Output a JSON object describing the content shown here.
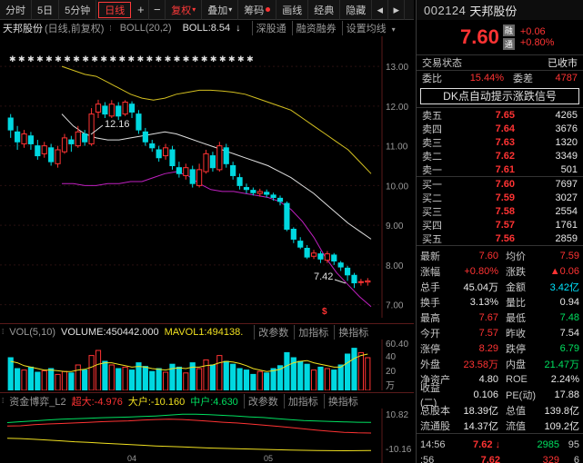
{
  "toolbar": {
    "fenshi": "分时",
    "day5": "5日",
    "min5": "5分钟",
    "daily": "日线",
    "plus": "+",
    "minus": "−",
    "fuquan": "复权",
    "overlay": "叠加",
    "chips": "筹码",
    "draw": "画线",
    "classic": "经典",
    "hide": "隐藏",
    "back": "◂",
    "fwd": "▸"
  },
  "kline_info": {
    "stock": "天邦股份",
    "mode": "(日线,前复权)",
    "boll": "BOLL(20,2)",
    "boll_val": "BOLL:8.54",
    "tab1": "深股通",
    "tab2": "融资融券",
    "tab3": "设置均线"
  },
  "kline_axis": {
    "ticks": [
      "13.00",
      "12.00",
      "11.00",
      "10.00",
      "9.00",
      "8.00",
      "7.00"
    ]
  },
  "kline_annotations": {
    "high": "12.16",
    "low": "7.42",
    "marker": "$"
  },
  "vol_info": {
    "title": "VOL(5,10)",
    "volume": "VOLUME:450442.000",
    "mavol": "MAVOL1:494138.",
    "param": "改参数",
    "add": "加指标",
    "swap": "换指标"
  },
  "vol_axis": {
    "ticks": [
      "60.40",
      "40",
      "20"
    ],
    "unit": "万"
  },
  "capital_info": {
    "title": "资金博弈_L2",
    "super": "超大:-4.976",
    "large": "大户:-10.160",
    "mid": "中户:4.630",
    "param": "改参数",
    "add": "加指标",
    "swap": "换指标"
  },
  "capital_axis": {
    "ticks": [
      "10.82",
      "-10.16"
    ]
  },
  "xaxis": {
    "labels": [
      "04",
      "05"
    ]
  },
  "quote": {
    "code": "002124",
    "name": "天邦股份",
    "price": "7.60",
    "badge1": "融",
    "badge2": "通",
    "change": "+0.06",
    "change_pct": "+0.80%",
    "status_label": "交易状态",
    "status_value": "已收市",
    "weibi_label": "委比",
    "weibi_value": "15.44%",
    "weicha_label": "委差",
    "weicha_value": "4787",
    "signal": "DK点自动提示涨跌信号"
  },
  "orderbook": {
    "asks": [
      {
        "label": "卖五",
        "price": "7.65",
        "vol": "4265"
      },
      {
        "label": "卖四",
        "price": "7.64",
        "vol": "3676"
      },
      {
        "label": "卖三",
        "price": "7.63",
        "vol": "1320"
      },
      {
        "label": "卖二",
        "price": "7.62",
        "vol": "3349"
      },
      {
        "label": "卖一",
        "price": "7.61",
        "vol": "501"
      }
    ],
    "bids": [
      {
        "label": "买一",
        "price": "7.60",
        "vol": "7697"
      },
      {
        "label": "买二",
        "price": "7.59",
        "vol": "3027"
      },
      {
        "label": "买三",
        "price": "7.58",
        "vol": "2554"
      },
      {
        "label": "买四",
        "price": "7.57",
        "vol": "1761"
      },
      {
        "label": "买五",
        "price": "7.56",
        "vol": "2859"
      }
    ]
  },
  "stats": [
    {
      "a": "最新",
      "b": "7.60",
      "bc": "#ff3333",
      "c": "均价",
      "d": "7.59",
      "dc": "#ff3333"
    },
    {
      "a": "涨幅",
      "b": "+0.80%",
      "bc": "#ff3333",
      "c": "涨跌",
      "d": "▲0.06",
      "dc": "#ff3333"
    },
    {
      "a": "总手",
      "b": "45.04万",
      "bc": "#e8e8e8",
      "c": "金额",
      "d": "3.42亿",
      "dc": "#00e5ff"
    },
    {
      "a": "换手",
      "b": "3.13%",
      "bc": "#e8e8e8",
      "c": "量比",
      "d": "0.94",
      "dc": "#e8e8e8"
    },
    {
      "a": "最高",
      "b": "7.67",
      "bc": "#ff3333",
      "c": "最低",
      "d": "7.48",
      "dc": "#00e060"
    },
    {
      "a": "今开",
      "b": "7.57",
      "bc": "#ff3333",
      "c": "昨收",
      "d": "7.54",
      "dc": "#e8e8e8"
    },
    {
      "a": "涨停",
      "b": "8.29",
      "bc": "#ff3333",
      "c": "跌停",
      "d": "6.79",
      "dc": "#00e060"
    },
    {
      "a": "外盘",
      "b": "23.58万",
      "bc": "#ff3333",
      "c": "内盘",
      "d": "21.47万",
      "dc": "#00e060"
    },
    {
      "a": "净资产",
      "b": "4.80",
      "bc": "#e8e8e8",
      "c": "ROE",
      "d": "2.24%",
      "dc": "#e8e8e8"
    },
    {
      "a": "收益(二)",
      "b": "0.106",
      "bc": "#e8e8e8",
      "c": "PE(动)",
      "d": "17.88",
      "dc": "#e8e8e8"
    },
    {
      "a": "总股本",
      "b": "18.39亿",
      "bc": "#e8e8e8",
      "c": "总值",
      "d": "139.8亿",
      "dc": "#e8e8e8"
    },
    {
      "a": "流通股",
      "b": "14.37亿",
      "bc": "#e8e8e8",
      "c": "流值",
      "d": "109.2亿",
      "dc": "#e8e8e8"
    }
  ],
  "ticks": [
    {
      "t": "14:56",
      "p": "7.62",
      "arrow": "↓",
      "v": "2985",
      "vc": "#00e060",
      "k": "95"
    },
    {
      "t": ":56",
      "p": "7.62",
      "arrow": "",
      "v": "329",
      "vc": "#ff3333",
      "k": "6"
    },
    {
      "t": ":57",
      "p": "7.62",
      "arrow": "",
      "v": "137",
      "vc": "#ff3333",
      "k": "7"
    }
  ],
  "chart_data": {
    "type": "candlestick",
    "title": "天邦股份 (日线,前复权)",
    "ylim": [
      6.9,
      13.3
    ],
    "candles": [
      [
        11.7,
        11.4,
        11.8,
        11.2
      ],
      [
        11.35,
        11.1,
        11.5,
        10.9
      ],
      [
        11.05,
        11.3,
        11.4,
        10.95
      ],
      [
        11.25,
        11.05,
        11.35,
        10.9
      ],
      [
        11.0,
        10.75,
        11.15,
        10.65
      ],
      [
        10.8,
        11.0,
        11.1,
        10.7
      ],
      [
        10.95,
        10.6,
        11.05,
        10.5
      ],
      [
        10.55,
        10.9,
        11.0,
        10.45
      ],
      [
        10.85,
        11.2,
        11.3,
        10.8
      ],
      [
        11.15,
        11.05,
        11.25,
        10.85
      ],
      [
        11.0,
        11.35,
        11.5,
        10.95
      ],
      [
        11.3,
        11.1,
        11.4,
        11.0
      ],
      [
        11.05,
        11.8,
        11.95,
        11.0
      ],
      [
        11.85,
        12.05,
        12.16,
        11.7
      ],
      [
        12.0,
        11.8,
        12.1,
        11.7
      ],
      [
        11.75,
        12.05,
        12.15,
        11.7
      ],
      [
        12.0,
        11.75,
        12.1,
        11.65
      ],
      [
        11.8,
        12.1,
        12.15,
        11.75
      ],
      [
        12.05,
        11.85,
        12.12,
        11.7
      ],
      [
        11.8,
        11.4,
        11.9,
        11.3
      ],
      [
        11.35,
        11.1,
        11.45,
        11.0
      ],
      [
        11.05,
        10.95,
        11.15,
        10.85
      ],
      [
        10.9,
        10.7,
        11.0,
        10.6
      ],
      [
        10.75,
        10.95,
        11.05,
        10.65
      ],
      [
        10.9,
        10.5,
        11.0,
        10.4
      ],
      [
        10.45,
        10.3,
        10.6,
        10.2
      ],
      [
        10.25,
        10.45,
        10.55,
        10.15
      ],
      [
        10.4,
        10.05,
        10.5,
        9.95
      ],
      [
        10.0,
        10.4,
        10.55,
        9.95
      ],
      [
        10.35,
        10.8,
        10.9,
        10.3
      ],
      [
        10.75,
        10.45,
        10.85,
        10.35
      ],
      [
        10.4,
        11.0,
        11.1,
        10.35
      ],
      [
        10.95,
        10.55,
        11.05,
        10.45
      ],
      [
        10.5,
        10.25,
        10.6,
        10.15
      ],
      [
        10.2,
        10.0,
        10.3,
        9.9
      ],
      [
        9.95,
        9.9,
        10.05,
        9.8
      ],
      [
        9.88,
        9.82,
        9.95,
        9.75
      ],
      [
        9.8,
        9.85,
        9.92,
        9.72
      ],
      [
        9.83,
        9.78,
        9.9,
        9.7
      ],
      [
        9.76,
        9.7,
        9.82,
        9.62
      ],
      [
        9.68,
        9.6,
        9.75,
        9.5
      ],
      [
        9.55,
        8.9,
        9.6,
        8.85
      ],
      [
        8.9,
        8.65,
        8.95,
        8.55
      ],
      [
        8.6,
        8.45,
        8.7,
        8.4
      ],
      [
        8.42,
        8.2,
        8.5,
        8.15
      ],
      [
        8.22,
        8.3,
        8.38,
        8.15
      ],
      [
        8.28,
        8.15,
        8.35,
        8.05
      ],
      [
        8.12,
        8.28,
        8.35,
        8.05
      ],
      [
        8.25,
        8.1,
        8.3,
        8.0
      ],
      [
        8.05,
        7.95,
        8.1,
        7.85
      ],
      [
        7.92,
        7.75,
        7.98,
        7.6
      ],
      [
        7.74,
        7.55,
        7.8,
        7.42
      ],
      [
        7.56,
        7.58,
        7.65,
        7.48
      ],
      [
        7.57,
        7.6,
        7.67,
        7.48
      ]
    ],
    "boll_upper": [
      13.0,
      12.9,
      12.8,
      12.75,
      12.6,
      12.45,
      12.3,
      12.2,
      12.15,
      12.2,
      12.3,
      12.35,
      12.4,
      12.4,
      12.38,
      12.35,
      12.3,
      12.2,
      12.1,
      12.0,
      11.9,
      11.7,
      11.5,
      11.3,
      11.1,
      10.9,
      10.6,
      10.3
    ],
    "boll_mid": [
      11.8,
      11.5,
      11.3,
      11.2,
      11.15,
      11.15,
      11.2,
      11.25,
      11.3,
      11.35,
      11.3,
      11.2,
      11.1,
      11.0,
      10.9,
      10.8,
      10.7,
      10.6,
      10.5,
      10.35,
      10.2,
      10.0,
      9.8,
      9.55,
      9.3,
      9.05,
      8.85,
      8.65
    ],
    "boll_lower": [
      10.05,
      10.05,
      10.0,
      10.0,
      10.05,
      10.05,
      10.1,
      10.1,
      10.2,
      10.3,
      10.35,
      10.25,
      10.05,
      9.9,
      9.85,
      9.85,
      9.8,
      9.75,
      9.7,
      9.6,
      9.4,
      9.1,
      8.7,
      8.2,
      7.8,
      7.5,
      7.2,
      6.95
    ],
    "volume": [
      45,
      30,
      28,
      32,
      25,
      27,
      30,
      22,
      26,
      24,
      35,
      28,
      48,
      55,
      40,
      35,
      30,
      32,
      28,
      38,
      33,
      26,
      30,
      25,
      36,
      32,
      24,
      38,
      30,
      42,
      35,
      48,
      40,
      36,
      30,
      28,
      22,
      26,
      24,
      30,
      34,
      52,
      45,
      40,
      36,
      28,
      32,
      30,
      28,
      35,
      50,
      58,
      52,
      45
    ],
    "mavol": [
      40,
      38,
      34,
      32,
      30,
      28,
      28,
      27,
      26,
      26,
      28,
      29,
      32,
      36,
      38,
      38,
      36,
      34,
      32,
      33,
      32,
      30,
      29,
      28,
      30,
      31,
      30,
      32,
      32,
      34,
      35,
      38,
      40,
      39,
      37,
      34,
      30,
      28,
      26,
      27,
      29,
      34,
      38,
      40,
      41,
      38,
      36,
      34,
      32,
      32,
      38,
      44,
      48,
      50
    ],
    "capital_super": [
      6,
      6.5,
      7,
      7.5,
      8,
      8.2,
      8.5,
      8.8,
      9,
      9.2,
      9.5,
      9.8,
      10.3,
      10.8,
      10.82,
      10.6,
      10.2,
      9.8,
      9.3,
      8.9,
      8.3,
      7.7,
      7.2,
      6.9,
      6.6,
      6.4,
      6.2,
      6.1
    ],
    "capital_large": [
      4,
      4.2,
      4.8,
      5.2,
      5.5,
      5.8,
      6.1,
      6.5,
      6.8,
      7.0,
      7.4,
      7.8,
      8.0,
      7.8,
      7.3,
      6.8,
      6.2,
      5.8,
      5.2,
      4.6,
      3.9,
      3.2,
      2.4,
      1.6,
      1.0,
      0.4,
      0.1,
      0.0
    ],
    "capital_mid": [
      -3,
      -3.2,
      -3.6,
      -4,
      -4.5,
      -5,
      -5.3,
      -5.8,
      -6.2,
      -6.6,
      -7,
      -7.4,
      -7.7,
      -8,
      -8.3,
      -8.6,
      -8.8,
      -9,
      -9.2,
      -9.4,
      -9.6,
      -9.8,
      -9.9,
      -10,
      -10.1,
      -10.16,
      -10.1,
      -10.0
    ]
  }
}
